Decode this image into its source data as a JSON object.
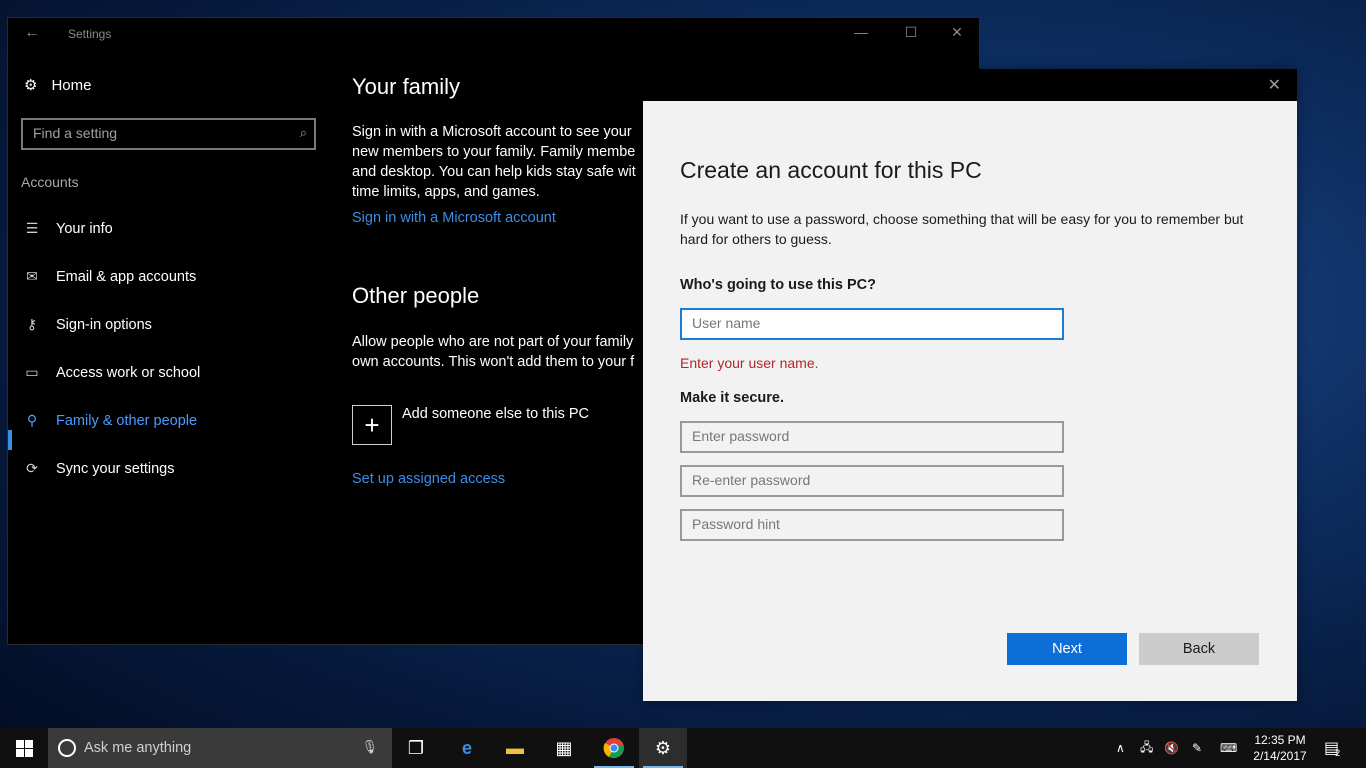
{
  "settings_window": {
    "title": "Settings",
    "back_icon": "back-arrow-icon",
    "controls": {
      "minimize": "—",
      "maximize": "☐",
      "close": "✕"
    }
  },
  "sidebar": {
    "home_label": "Home",
    "search_placeholder": "Find a setting",
    "section_label": "Accounts",
    "items": [
      {
        "label": "Your info",
        "icon": "user-info-icon"
      },
      {
        "label": "Email & app accounts",
        "icon": "mail-icon"
      },
      {
        "label": "Sign-in options",
        "icon": "key-icon"
      },
      {
        "label": "Access work or school",
        "icon": "briefcase-icon"
      },
      {
        "label": "Family & other people",
        "icon": "person-icon",
        "active": true
      },
      {
        "label": "Sync your settings",
        "icon": "sync-icon"
      }
    ]
  },
  "content": {
    "family_title": "Your family",
    "family_text_lines": [
      "Sign in with a Microsoft account to see your",
      "new members to your family. Family membe",
      "and desktop. You can help kids stay safe wit",
      "time limits, apps, and games."
    ],
    "family_link": "Sign in with a Microsoft account",
    "other_title": "Other people",
    "other_text_lines": [
      "Allow people who are not part of your family",
      "own accounts. This won't add them to your f"
    ],
    "add_label": "Add someone else to this PC",
    "assigned_access_link": "Set up assigned access"
  },
  "dialog": {
    "title": "Create an account for this PC",
    "description": "If you want to use a password, choose something that will be easy for you to remember but hard for others to guess.",
    "who_label": "Who's going to use this PC?",
    "username_placeholder": "User name",
    "error_text": "Enter your user name.",
    "secure_label": "Make it secure.",
    "password_placeholder": "Enter password",
    "reenter_placeholder": "Re-enter password",
    "hint_placeholder": "Password hint",
    "next_label": "Next",
    "back_label": "Back",
    "close_glyph": "✕"
  },
  "taskbar": {
    "search_placeholder": "Ask me anything",
    "time": "12:35 PM",
    "date": "2/14/2017",
    "notification_count": "2"
  }
}
